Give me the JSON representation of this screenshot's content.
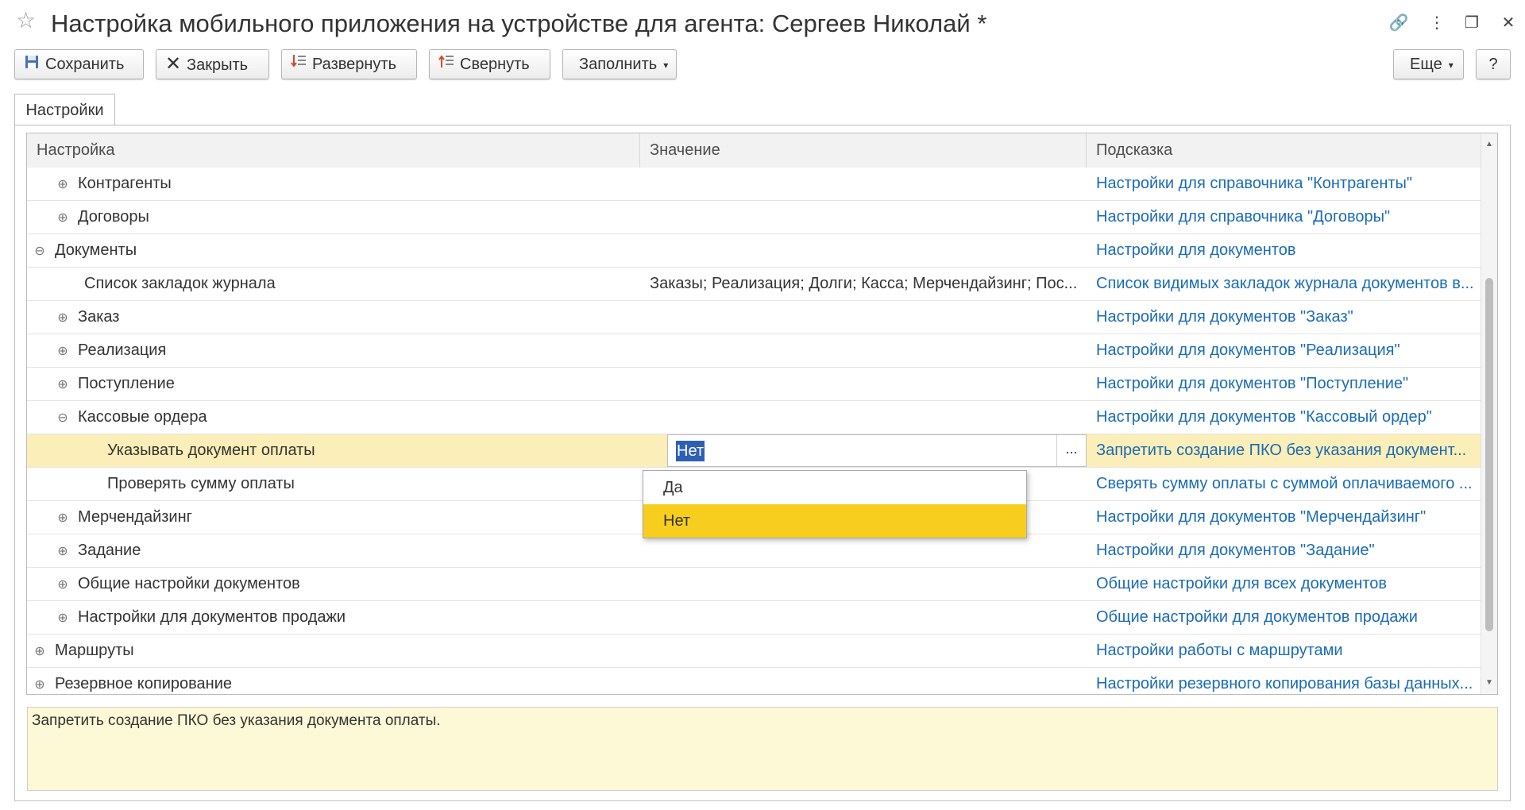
{
  "window": {
    "title": "Настройка мобильного приложения на устройстве для агента: Сергеев Николай *",
    "controls": {
      "link": "🔗",
      "more": "⋮",
      "restore": "❐",
      "close": "✕"
    }
  },
  "toolbar": {
    "save": "Сохранить",
    "close": "Закрыть",
    "expand": "Развернуть",
    "collapse": "Свернуть",
    "fill": "Заполнить",
    "more": "Еще",
    "help": "?"
  },
  "tabs": [
    {
      "label": "Настройки"
    }
  ],
  "grid": {
    "columns": {
      "setting": "Настройка",
      "value": "Значение",
      "hint": "Подсказка"
    },
    "rows": [
      {
        "name": "Контрагенты",
        "expander": "plus",
        "value": "",
        "hint": "Настройки для справочника \"Контрагенты\""
      },
      {
        "name": "Договоры",
        "expander": "plus",
        "value": "",
        "hint": "Настройки для справочника \"Договоры\""
      },
      {
        "name": "Документы",
        "expander": "minus",
        "value": "",
        "hint": "Настройки для документов"
      },
      {
        "name": "Список закладок журнала",
        "expander": "none",
        "value": "Заказы; Реализация; Долги; Касса; Мерчендайзинг; Пос...",
        "hint": "Список видимых закладок журнала документов в..."
      },
      {
        "name": "Заказ",
        "expander": "plus",
        "value": "",
        "hint": "Настройки для документов \"Заказ\""
      },
      {
        "name": "Реализация",
        "expander": "plus",
        "value": "",
        "hint": "Настройки для документов \"Реализация\""
      },
      {
        "name": "Поступление",
        "expander": "plus",
        "value": "",
        "hint": "Настройки для документов \"Поступление\""
      },
      {
        "name": "Кассовые ордера",
        "expander": "minus",
        "value": "",
        "hint": "Настройки для документов \"Кассовый ордер\""
      },
      {
        "name": "Указывать документ оплаты",
        "expander": "none",
        "value": "Нет",
        "hint": "Запретить создание ПКО без указания документ..."
      },
      {
        "name": "Проверять сумму оплаты",
        "expander": "none",
        "value": "",
        "hint": "Сверять сумму оплаты с суммой оплачиваемого ..."
      },
      {
        "name": "Мерчендайзинг",
        "expander": "plus",
        "value": "",
        "hint": "Настройки для документов \"Мерчендайзинг\""
      },
      {
        "name": "Задание",
        "expander": "plus",
        "value": "",
        "hint": "Настройки для документов \"Задание\""
      },
      {
        "name": "Общие настройки документов",
        "expander": "plus",
        "value": "",
        "hint": "Общие настройки для всех документов"
      },
      {
        "name": "Настройки для документов продажи",
        "expander": "plus",
        "value": "",
        "hint": "Общие настройки для документов продажи"
      },
      {
        "name": "Маршруты",
        "expander": "plus",
        "value": "",
        "hint": "Настройки работы с маршрутами"
      },
      {
        "name": "Резервное копирование",
        "expander": "plus",
        "value": "",
        "hint": "Настройки резервного копирования базы данных..."
      }
    ],
    "selected_row": 8
  },
  "dropdown": {
    "options": [
      "Да",
      "Нет"
    ],
    "selected": "Нет"
  },
  "hint_panel": {
    "text": "Запретить создание ПКО без указания документа оплаты."
  },
  "colors": {
    "link": "#1a6bb5",
    "selected_row": "#fbeeb8",
    "dropdown_selected": "#f7ce1e",
    "hint_panel": "#fdf8d6"
  }
}
